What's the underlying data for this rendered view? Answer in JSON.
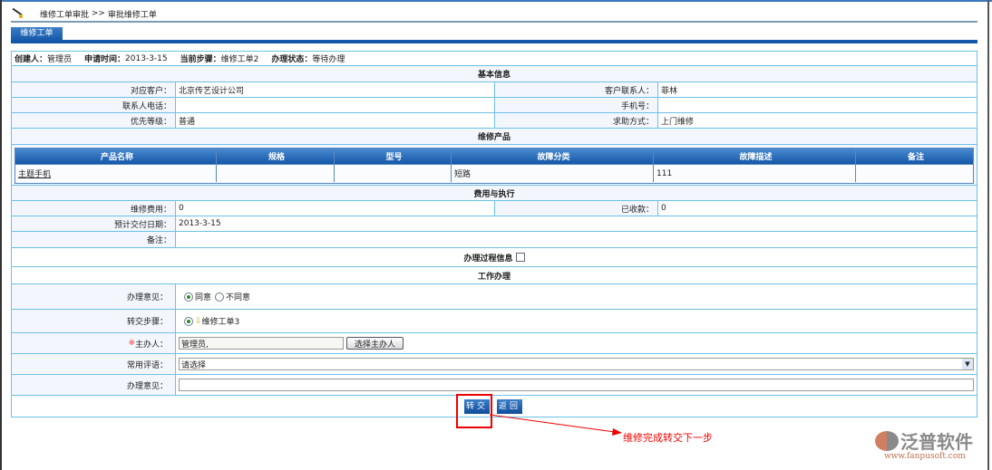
{
  "breadcrumb": {
    "parent": "维修工单审批",
    "sep": ">>",
    "current": "审批维修工单"
  },
  "tab": "维修工单",
  "header": {
    "creator_label": "创建人：",
    "creator": "管理员",
    "time_label": "申请时间：",
    "time": "2013-3-15",
    "step_label": "当前步骤：",
    "step": "维修工单2",
    "status_label": "办理状态：",
    "status": "等待办理"
  },
  "basic": {
    "title": "基本信息",
    "customer_label": "对应客户：",
    "customer": "北京传艺设计公司",
    "contact_label": "客户联系人：",
    "contact": "菲林",
    "phone_label": "联系人电话：",
    "phone": "",
    "mobile_label": "手机号：",
    "mobile": "",
    "priority_label": "优先等级：",
    "priority": "普通",
    "method_label": "求助方式：",
    "method": "上门维修"
  },
  "products": {
    "title": "维修产品",
    "columns": [
      "产品名称",
      "规格",
      "型号",
      "故障分类",
      "故障描述",
      "备注"
    ],
    "rows": [
      [
        "主题手机",
        "",
        "",
        "短路",
        "111",
        ""
      ]
    ]
  },
  "cost": {
    "title": "费用与执行",
    "fee_label": "维修费用：",
    "fee": "0",
    "received_label": "已收款：",
    "received": "0",
    "date_label": "预计交付日期：",
    "date": "2013-3-15",
    "remark_label": "备注：",
    "remark": ""
  },
  "process": {
    "title": "办理过程信息"
  },
  "work": {
    "title": "工作办理",
    "opinion_label": "办理意见：",
    "agree": "同意",
    "disagree": "不同意",
    "step_label": "转交步骤：",
    "next_step": "维修工单3",
    "handler_required": "※",
    "handler_label": "主办人：",
    "handler": "管理员,",
    "choose_handler": "选择主办人",
    "comment_label": "常用评语：",
    "comment_select": "请选择",
    "opinion2_label": "办理意见：",
    "opinion2": ""
  },
  "buttons": {
    "submit": "转交",
    "back": "返回"
  },
  "annotation": "维修完成转交下一步",
  "logo": {
    "name": "泛普软件",
    "url": "www.fanpusoft.com"
  }
}
